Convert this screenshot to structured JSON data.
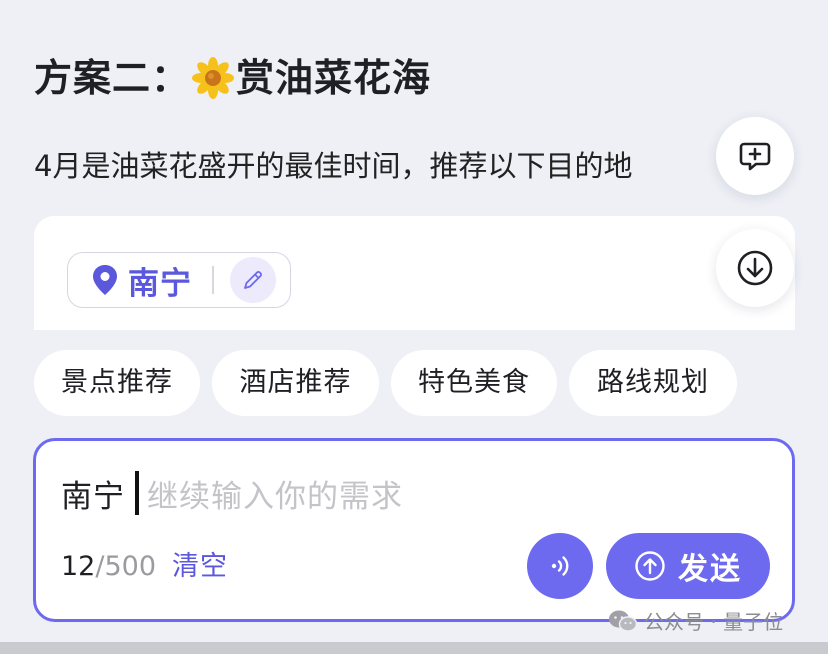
{
  "heading": {
    "prefix": "方案二：",
    "icon": "flower-icon",
    "title": "赏油菜花海"
  },
  "intro_text": "4月是油菜花盛开的最佳时间，推荐以下目的地",
  "location_card": {
    "location": "南宁",
    "pin_icon": "location-pin-icon",
    "edit_icon": "pencil-icon"
  },
  "floating_actions": {
    "feedback_icon": "chat-plus-icon",
    "download_icon": "download-icon"
  },
  "quick_chips": [
    {
      "label": "景点推荐"
    },
    {
      "label": "酒店推荐"
    },
    {
      "label": "特色美食"
    },
    {
      "label": "路线规划"
    }
  ],
  "composer": {
    "value": "南宁",
    "placeholder": "继续输入你的需求",
    "count_used": "12",
    "count_sep": "/",
    "count_max": "500",
    "clear_label": "清空",
    "voice_icon": "voice-icon",
    "send_label": "发送",
    "send_icon": "arrow-up-circle-icon"
  },
  "watermark": {
    "text": "公众号 · 量子位",
    "icon": "wechat-icon"
  },
  "colors": {
    "accent": "#6d6af0",
    "accent_text": "#5b58dd",
    "background": "#eef0f6"
  }
}
